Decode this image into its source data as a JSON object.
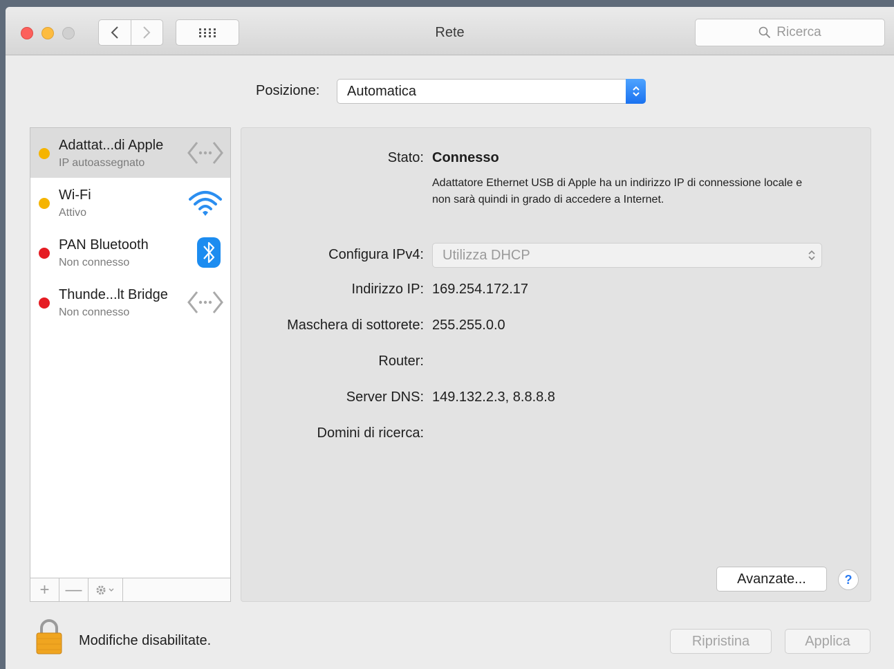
{
  "window": {
    "title": "Rete"
  },
  "search": {
    "placeholder": "Ricerca"
  },
  "location": {
    "label": "Posizione:",
    "value": "Automatica"
  },
  "services": [
    {
      "name": "Adattat...di Apple",
      "status": "IP autoassegnato",
      "dot_color": "#f5b400",
      "icon": "ethernet-icon",
      "selected": true
    },
    {
      "name": "Wi-Fi",
      "status": "Attivo",
      "dot_color": "#f5b400",
      "icon": "wifi-icon",
      "selected": false
    },
    {
      "name": "PAN Bluetooth",
      "status": "Non connesso",
      "dot_color": "#e51c23",
      "icon": "bluetooth-icon",
      "selected": false
    },
    {
      "name": "Thunde...lt Bridge",
      "status": "Non connesso",
      "dot_color": "#e51c23",
      "icon": "ethernet-icon",
      "selected": false
    }
  ],
  "sidebar_toolbar": {
    "add": "+",
    "remove": "—"
  },
  "detail": {
    "state_label": "Stato:",
    "state_value": "Connesso",
    "state_description": "Adattatore Ethernet USB di Apple ha un indirizzo IP di connessione locale e non sarà quindi in grado di accedere a Internet.",
    "ipv4_label": "Configura IPv4:",
    "ipv4_value": "Utilizza DHCP",
    "ip_label": "Indirizzo IP:",
    "ip_value": "169.254.172.17",
    "subnet_label": "Maschera di sottorete:",
    "subnet_value": "255.255.0.0",
    "router_label": "Router:",
    "router_value": "",
    "dns_label": "Server DNS:",
    "dns_value": "149.132.2.3, 8.8.8.8",
    "search_domains_label": "Domini di ricerca:",
    "search_domains_value": "",
    "advanced_button": "Avanzate...",
    "help_button": "?"
  },
  "footer": {
    "lock_text": "Modifiche disabilitate.",
    "revert_button": "Ripristina",
    "apply_button": "Applica"
  },
  "colors": {
    "accent": "#1a72f0",
    "status_yellow": "#f5b400",
    "status_red": "#e51c23"
  }
}
